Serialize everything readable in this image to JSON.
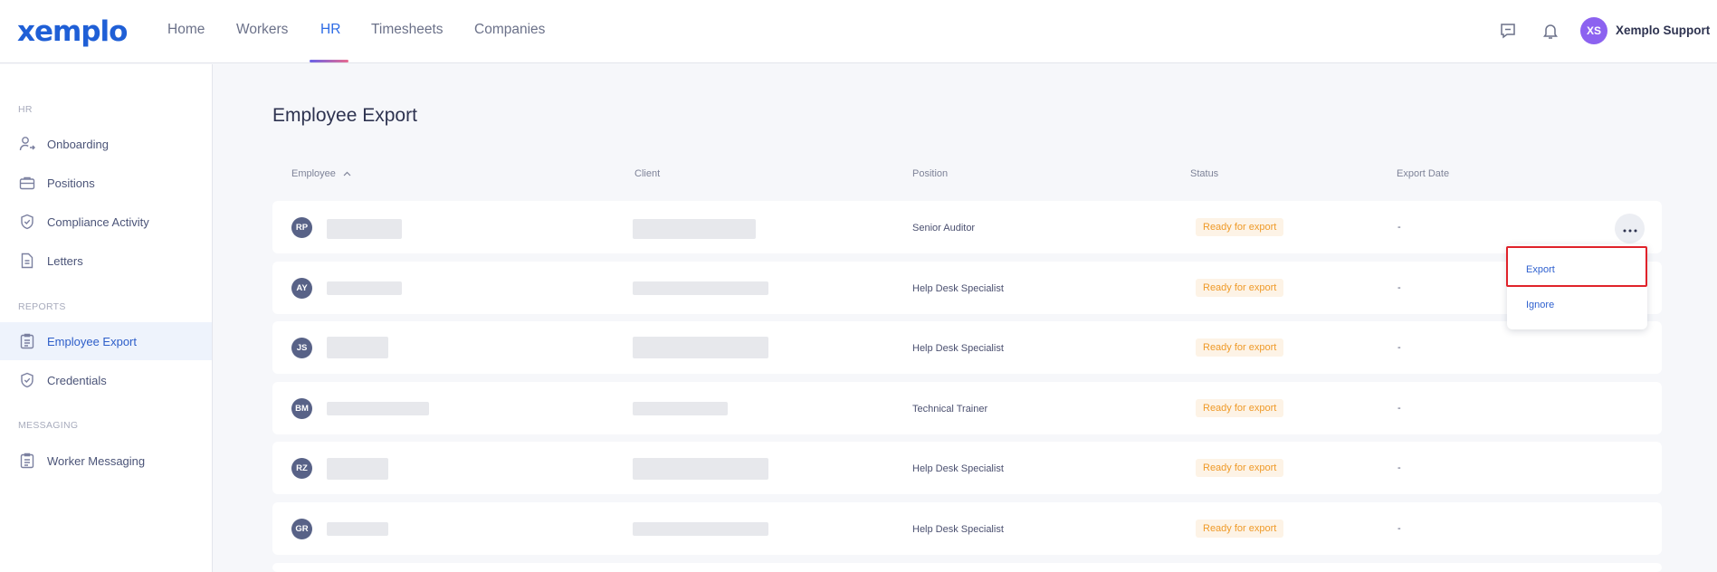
{
  "app": {
    "logo": "xemplo"
  },
  "nav": {
    "items": [
      {
        "label": "Home",
        "active": false
      },
      {
        "label": "Workers",
        "active": false
      },
      {
        "label": "HR",
        "active": true
      },
      {
        "label": "Timesheets",
        "active": false
      },
      {
        "label": "Companies",
        "active": false
      }
    ],
    "icons": [
      "chat-icon",
      "bell-icon"
    ],
    "user": {
      "initials": "XS",
      "name": "Xemplo Support",
      "avatar_color": "#8c62f0"
    }
  },
  "sidebar": {
    "sections": [
      {
        "title": "HR",
        "items": [
          {
            "label": "Onboarding",
            "icon": "user-arrow-icon"
          },
          {
            "label": "Positions",
            "icon": "briefcase-icon"
          },
          {
            "label": "Compliance Activity",
            "icon": "shield-check-icon"
          },
          {
            "label": "Letters",
            "icon": "document-icon"
          }
        ]
      },
      {
        "title": "REPORTS",
        "items": [
          {
            "label": "Employee Export",
            "icon": "clipboard-list-icon",
            "active": true
          },
          {
            "label": "Credentials",
            "icon": "shield-check-icon"
          }
        ]
      },
      {
        "title": "MESSAGING",
        "items": [
          {
            "label": "Worker Messaging",
            "icon": "clipboard-list-icon"
          }
        ]
      }
    ]
  },
  "main": {
    "title": "Employee Export",
    "columns": [
      "Employee",
      "Client",
      "Position",
      "Status",
      "Export Date"
    ],
    "sort_indicator": "chevron-up-icon",
    "rows": [
      {
        "initials": "RP",
        "position": "Senior Auditor",
        "status": "Ready for export",
        "export_date": "-"
      },
      {
        "initials": "AY",
        "position": "Help Desk Specialist",
        "status": "Ready for export",
        "export_date": "-"
      },
      {
        "initials": "JS",
        "position": "Help Desk Specialist",
        "status": "Ready for export",
        "export_date": "-"
      },
      {
        "initials": "BM",
        "position": "Technical Trainer",
        "status": "Ready for export",
        "export_date": "-"
      },
      {
        "initials": "RZ",
        "position": "Help Desk Specialist",
        "status": "Ready for export",
        "export_date": "-"
      },
      {
        "initials": "GR",
        "position": "Help Desk Specialist",
        "status": "Ready for export",
        "export_date": "-"
      }
    ],
    "status_colors": {
      "text": "#ef9a28",
      "background": "#fdf3e6"
    }
  },
  "row_menu": {
    "items": [
      "Export",
      "Ignore"
    ],
    "highlighted": "Export"
  }
}
